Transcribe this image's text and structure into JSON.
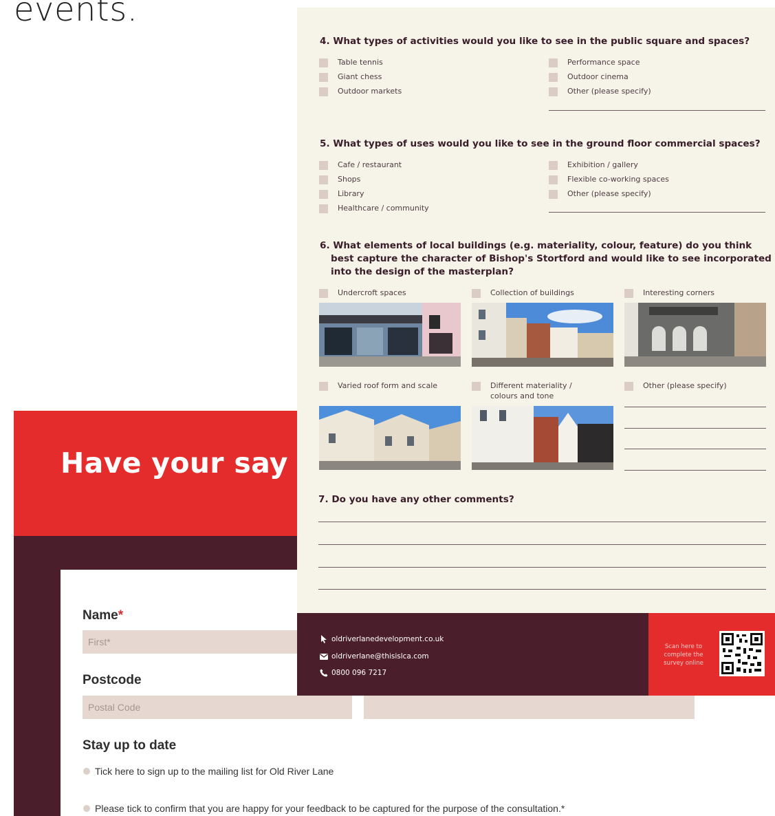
{
  "page_heading": "events.",
  "web_form": {
    "hero_title": "Have your say",
    "name_label": "Name",
    "name_required_mark": "*",
    "first_placeholder": "First*",
    "postcode_label": "Postcode",
    "postcode_placeholder": "Postal Code",
    "stay_label": "Stay up to date",
    "mailing_list_label": "Tick here to sign up to the mailing list for Old River Lane",
    "consent_label": "Please tick to confirm that you are happy for your feedback to be captured for the purpose of the consultation.*"
  },
  "survey": {
    "q4": {
      "title": "4. What types of activities would you like to see in the public square and spaces?",
      "options": [
        "Table tennis",
        "Giant chess",
        "Outdoor markets",
        "Performance space",
        "Outdoor cinema",
        "Other (please specify)"
      ]
    },
    "q5": {
      "title": "5. What types of uses would you like to see in the ground floor commercial spaces?",
      "options": [
        "Cafe / restaurant",
        "Shops",
        "Library",
        "Healthcare / community",
        "Exhibition / gallery",
        "Flexible co-working spaces",
        "Other (please specify)"
      ]
    },
    "q6": {
      "title_lines": [
        "6. What elements of local buildings (e.g. materiality, colour, feature) do you think",
        "best capture the character of Bishop's Stortford and would like to see incorporated",
        "into the design of the masterplan?"
      ],
      "options": [
        "Undercroft spaces",
        "Collection of buildings",
        "Interesting corners",
        "Varied roof form and scale",
        "Different materiality /",
        "colours and tone",
        "Other (please specify)"
      ]
    },
    "q7": {
      "title": "7. Do you have any other comments?"
    }
  },
  "footer": {
    "website": "oldriverlanedevelopment.co.uk",
    "email": "oldriverlane@thisislca.com",
    "phone": "0800 096 7217",
    "scan_text": "Scan here to complete the survey online"
  },
  "colors": {
    "brand_red": "#e42c2c",
    "maroon": "#4a1f2b",
    "paper": "#f6f3e8",
    "field": "#e6d8d1"
  },
  "icons": [
    "cursor-icon",
    "envelope-icon",
    "phone-icon",
    "qr-code"
  ]
}
